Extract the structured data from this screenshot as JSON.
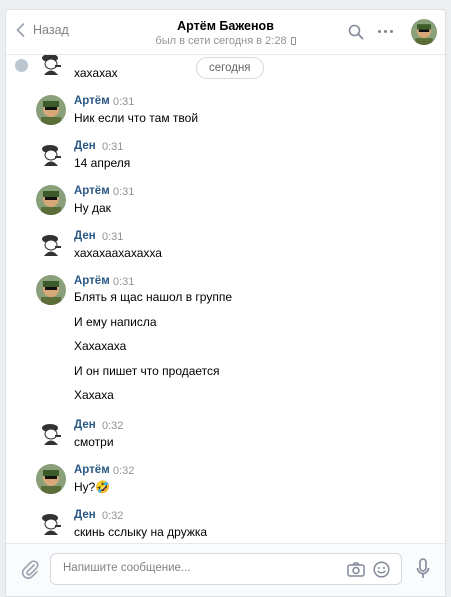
{
  "header": {
    "back_label": "Назад",
    "title": "Артём Баженов",
    "status": "был в сети сегодня в 2:28"
  },
  "history": {
    "date_divider": "сегодня",
    "prev_tail": "хахахах",
    "messages": [
      {
        "author": "Артём",
        "time": "0:31",
        "lines": [
          "Ник если что там твой"
        ]
      },
      {
        "author": "Ден",
        "time": "0:31",
        "lines": [
          "14 апреля"
        ]
      },
      {
        "author": "Артём",
        "time": "0:31",
        "lines": [
          "Ну дак"
        ]
      },
      {
        "author": "Ден",
        "time": "0:31",
        "lines": [
          "хахахаахахахха"
        ]
      },
      {
        "author": "Артём",
        "time": "0:31",
        "lines": [
          "Блять я щас нашол в группе",
          "И ему написла",
          "Хахахаха",
          "И он пишет что продается",
          "Хахаха"
        ]
      },
      {
        "author": "Ден",
        "time": "0:32",
        "lines": [
          "смотри"
        ]
      },
      {
        "author": "Артём",
        "time": "0:32",
        "lines": [
          "Ну?🤣"
        ]
      },
      {
        "author": "Ден",
        "time": "0:32",
        "lines": [
          "скинь сслыку на дружка"
        ]
      }
    ]
  },
  "composer": {
    "placeholder": "Напишите сообщение..."
  },
  "colors": {
    "author": "#2a5885",
    "muted": "#939393",
    "border": "#e7e8ec"
  },
  "icons": {
    "back": "chevron-left-icon",
    "search": "search-icon",
    "more": "more-dots-icon",
    "attach": "paperclip-icon",
    "camera": "camera-icon",
    "emoji": "smile-icon",
    "voice": "microphone-icon"
  }
}
